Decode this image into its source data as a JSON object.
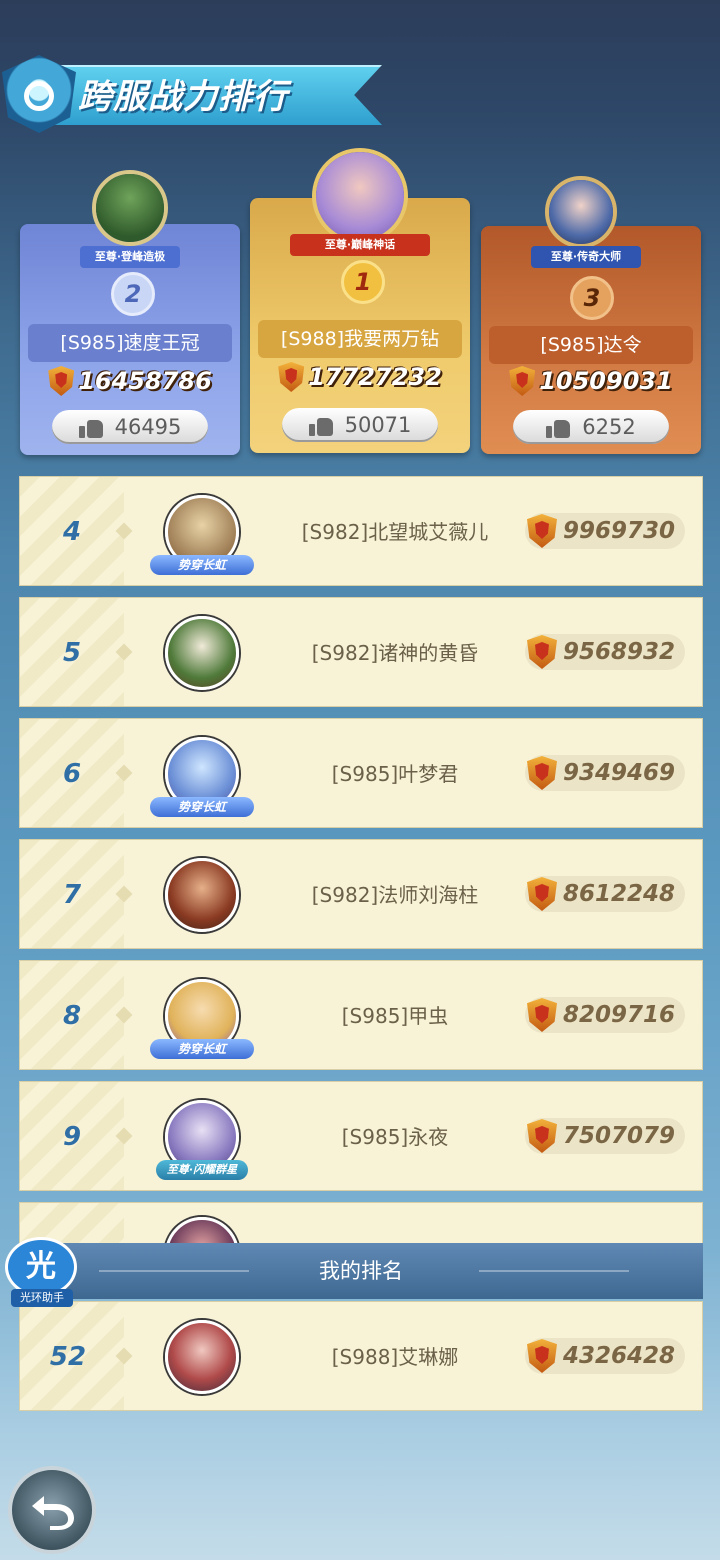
{
  "header": {
    "title": "跨服战力排行"
  },
  "podium": [
    {
      "rank": "2",
      "title_tag": "至尊·登峰造极",
      "name": "[S985]速度王冠",
      "power": "16458786",
      "likes": "46495"
    },
    {
      "rank": "1",
      "title_tag": "至尊·巅峰神话",
      "name": "[S988]我要两万钻",
      "power": "17727232",
      "likes": "50071"
    },
    {
      "rank": "3",
      "title_tag": "至尊·传奇大师",
      "name": "[S985]达令",
      "power": "10509031",
      "likes": "6252"
    }
  ],
  "list": [
    {
      "rank": "4",
      "name": "[S982]北望城艾薇儿",
      "power": "9969730",
      "frame_tag": "势穿长虹"
    },
    {
      "rank": "5",
      "name": "[S982]诸神的黄昏",
      "power": "9568932",
      "frame_tag": ""
    },
    {
      "rank": "6",
      "name": "[S985]叶梦君",
      "power": "9349469",
      "frame_tag": "势穿长虹"
    },
    {
      "rank": "7",
      "name": "[S982]法师刘海柱",
      "power": "8612248",
      "frame_tag": ""
    },
    {
      "rank": "8",
      "name": "[S985]甲虫",
      "power": "8209716",
      "frame_tag": "势穿长虹"
    },
    {
      "rank": "9",
      "name": "[S985]永夜",
      "power": "7507079",
      "frame_tag": "至尊·闪耀群星"
    }
  ],
  "my_rank": {
    "header": "我的排名",
    "rank": "52",
    "name": "[S988]艾琳娜",
    "power": "4326428"
  },
  "helper": {
    "glyph": "光",
    "label": "光环助手"
  },
  "colors": {
    "gold": "#efcb6c",
    "silver_blue": "#8fa5ea",
    "bronze": "#d27b44",
    "rank_blue": "#2f6fa6"
  }
}
